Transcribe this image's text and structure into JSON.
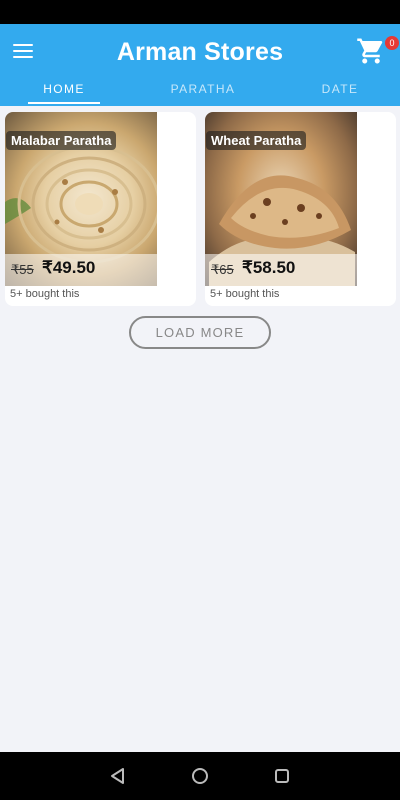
{
  "app": {
    "title": "Arman Stores"
  },
  "cart": {
    "icon": "shopping-cart-icon",
    "count": "0"
  },
  "menu": {
    "icon": "hamburger-menu-icon"
  },
  "tabs": [
    {
      "label": "HOME",
      "active": true
    },
    {
      "label": "PARATHA",
      "active": false
    },
    {
      "label": "DATE",
      "active": false
    }
  ],
  "products": [
    {
      "name": "Malabar Paratha",
      "original_price": "₹55",
      "price": "₹49.50",
      "sales": "5+ bought this"
    },
    {
      "name": "Wheat Paratha",
      "original_price": "₹65",
      "price": "₹58.50",
      "sales": "5+ bought this"
    }
  ],
  "load_more": {
    "label": "LOAD MORE"
  },
  "navigation": {
    "back_icon": "back-triangle-icon",
    "home_icon": "home-circle-icon",
    "recent_icon": "recent-apps-square-icon"
  },
  "colors": {
    "app_bar": "#33aaee",
    "background": "#f2f3f8",
    "badge": "#e53935"
  }
}
